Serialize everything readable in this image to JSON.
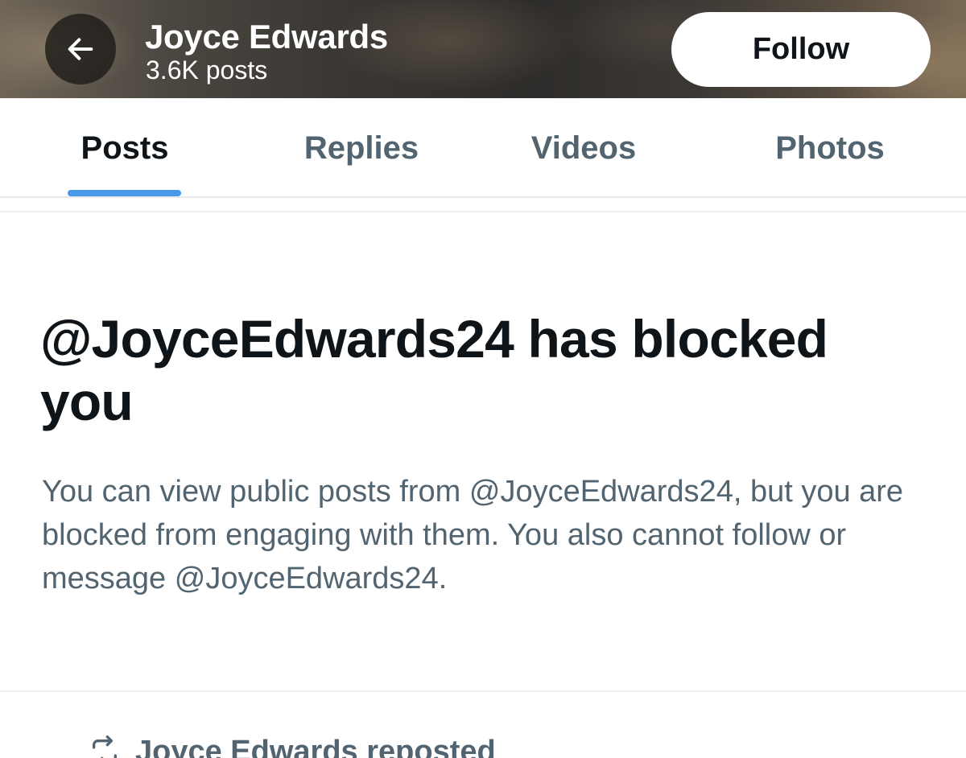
{
  "header": {
    "name": "Joyce Edwards",
    "post_count": "3.6K posts",
    "follow_label": "Follow",
    "back_icon": "arrow-left-icon"
  },
  "tabs": [
    {
      "label": "Posts",
      "active": true
    },
    {
      "label": "Replies",
      "active": false
    },
    {
      "label": "Videos",
      "active": false
    },
    {
      "label": "Photos",
      "active": false
    }
  ],
  "blocked": {
    "title": "@JoyceEdwards24 has blocked you",
    "description": "You can view public posts from @JoyceEdwards24, but you are blocked from engaging with them. You also cannot follow or message @JoyceEdwards24."
  },
  "next_item": {
    "icon": "repost-icon",
    "text": "Joyce Edwards reposted"
  },
  "colors": {
    "accent": "#4a99e9",
    "primary_text": "#0f1419",
    "secondary_text": "#536471"
  }
}
